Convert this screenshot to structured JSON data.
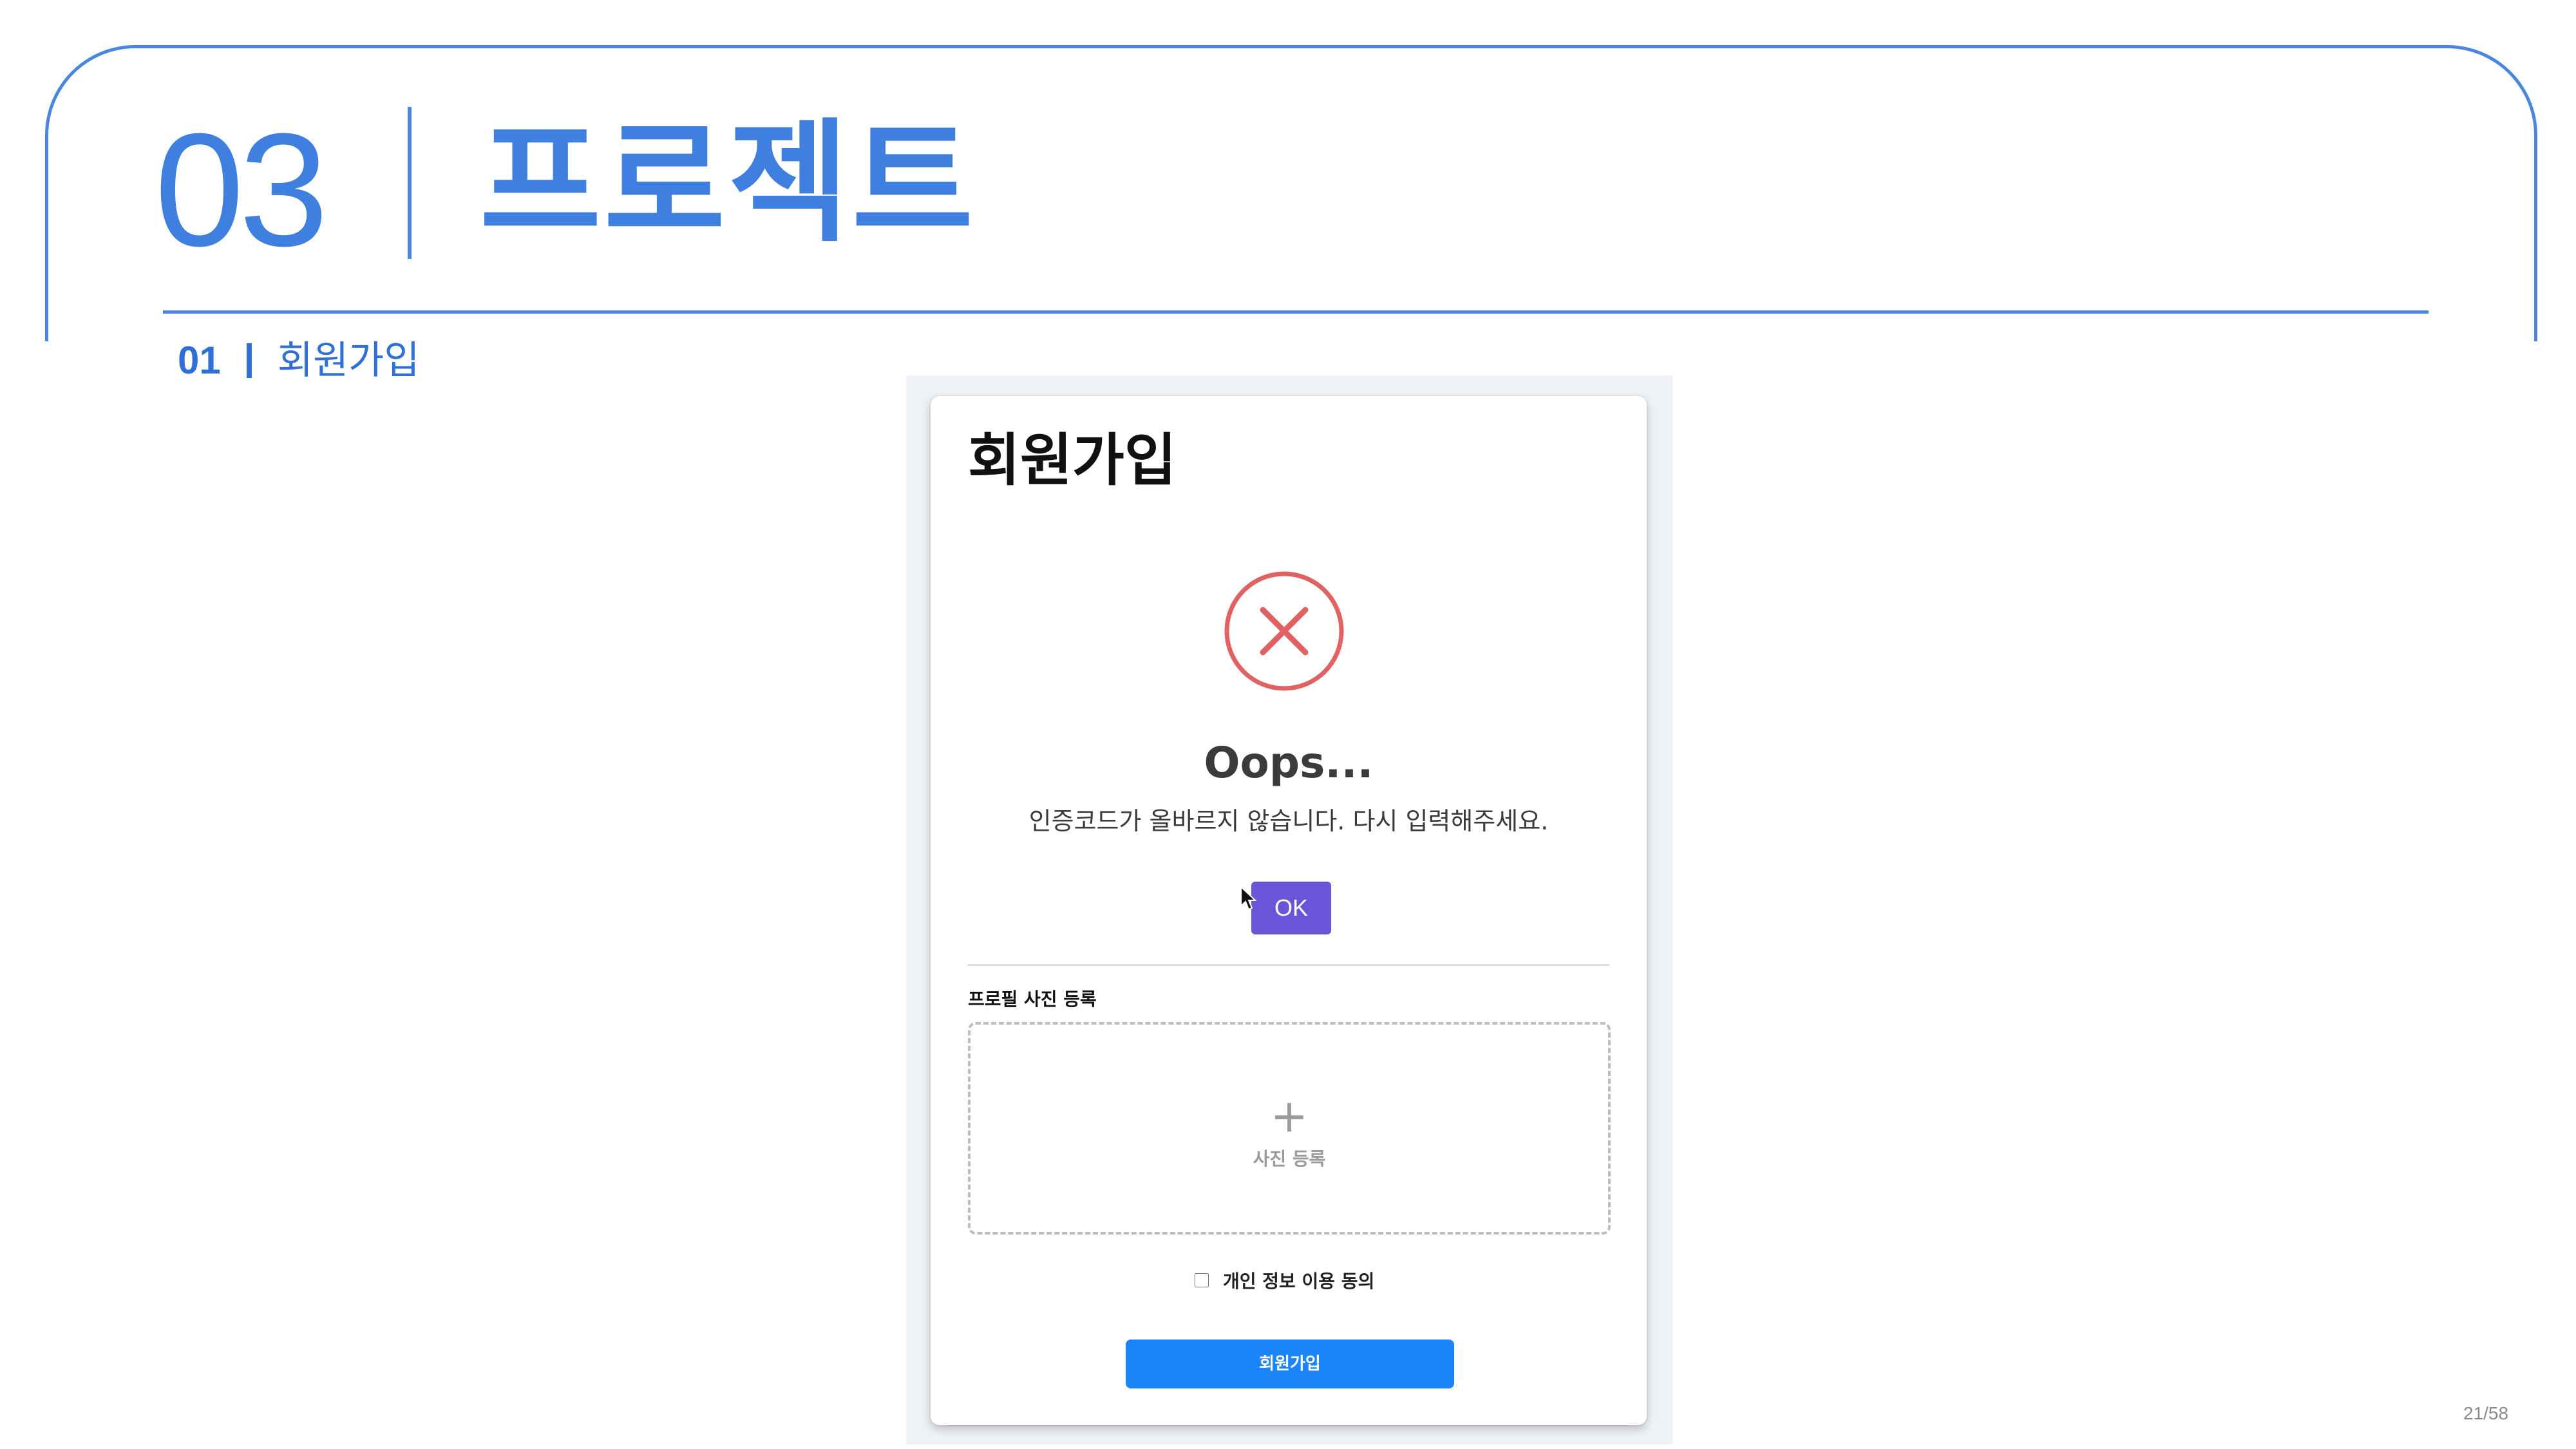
{
  "slide": {
    "section_number": "03",
    "section_title": "프로젝트",
    "subheading_number": "01",
    "subheading_title": "회원가입",
    "page_number": "21/58",
    "accent_color": "#3f7fe0"
  },
  "signup_screen": {
    "title": "회원가입",
    "alert": {
      "icon": "error-x-circle-icon",
      "icon_color": "#e06262",
      "heading": "Oops...",
      "message": "인증코드가 올바르지 않습니다. 다시 입력해주세요.",
      "ok_label": "OK",
      "ok_color": "#6a55d8"
    },
    "profile_photo": {
      "label": "프로필 사진 등록",
      "plus": "+",
      "upload_text": "사진 등록"
    },
    "consent": {
      "label": "개인 정보 이용 동의",
      "checked": false
    },
    "submit_label": "회원가입",
    "submit_color": "#1b84f7"
  }
}
